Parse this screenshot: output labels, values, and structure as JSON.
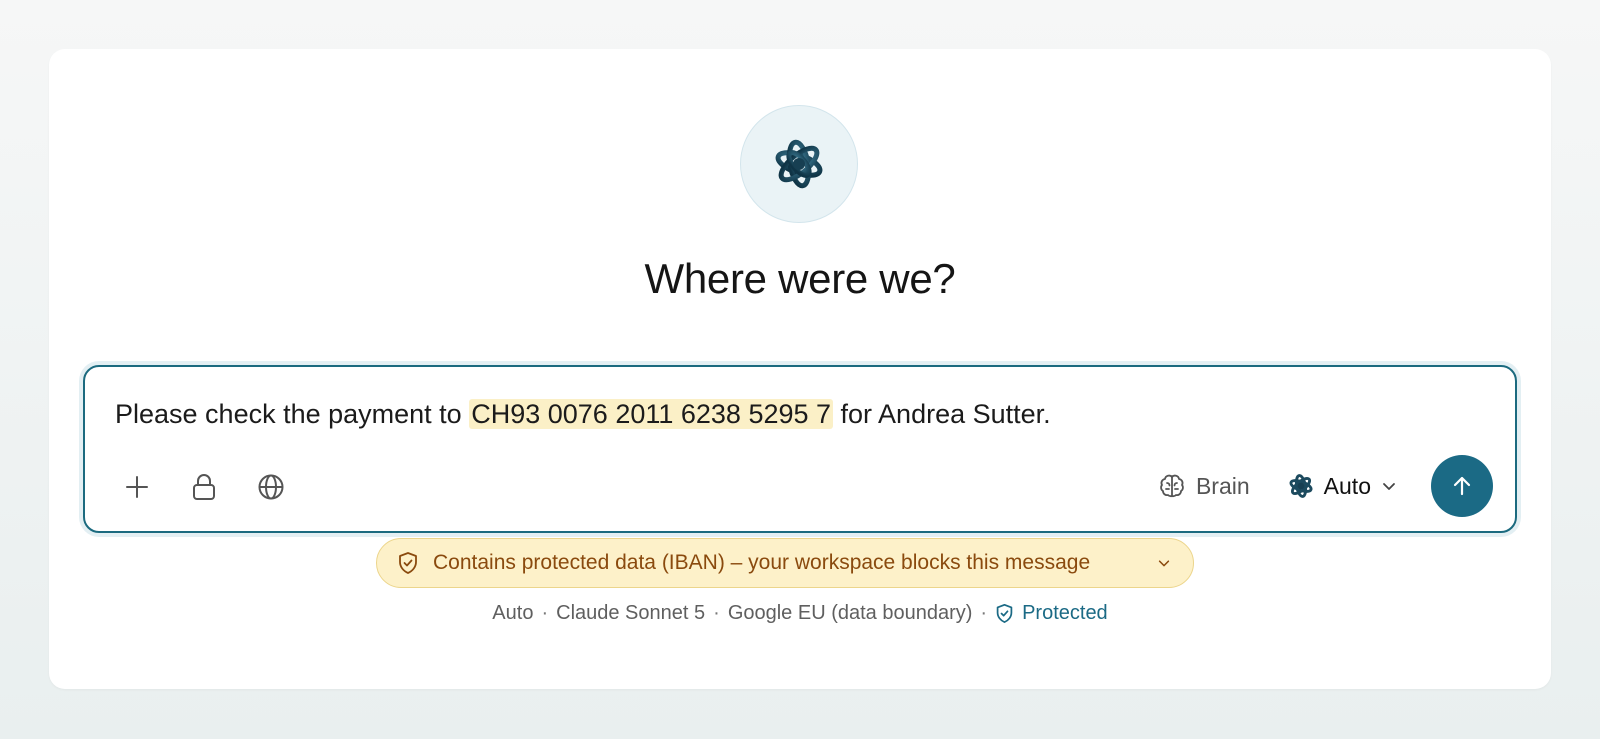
{
  "header": {
    "title": "Where were we?",
    "logo_icon": "brain-sphere-icon"
  },
  "composer": {
    "message_before": "Please check the payment to ",
    "message_highlight": "CH93 0076 2011 6238 5295 7",
    "message_after": " for Andrea Sutter.",
    "tools": [
      "plus-icon",
      "lock-icon",
      "globe-icon"
    ],
    "brain_label": "Brain",
    "model_label": "Auto",
    "send_icon": "arrow-up-icon"
  },
  "warning": {
    "text": "Contains protected data (IBAN) – your workspace blocks this message"
  },
  "footer": {
    "mode": "Auto",
    "sep1": "·",
    "model": "Claude Sonnet 5",
    "sep2": "·",
    "region": "Google EU (data boundary)",
    "sep3": "·",
    "status": "Protected"
  },
  "colors": {
    "accent": "#1b6a85",
    "highlight": "#fbf0c7",
    "warning_bg": "#fdf1c9",
    "warning_text": "#8a4a0e"
  }
}
